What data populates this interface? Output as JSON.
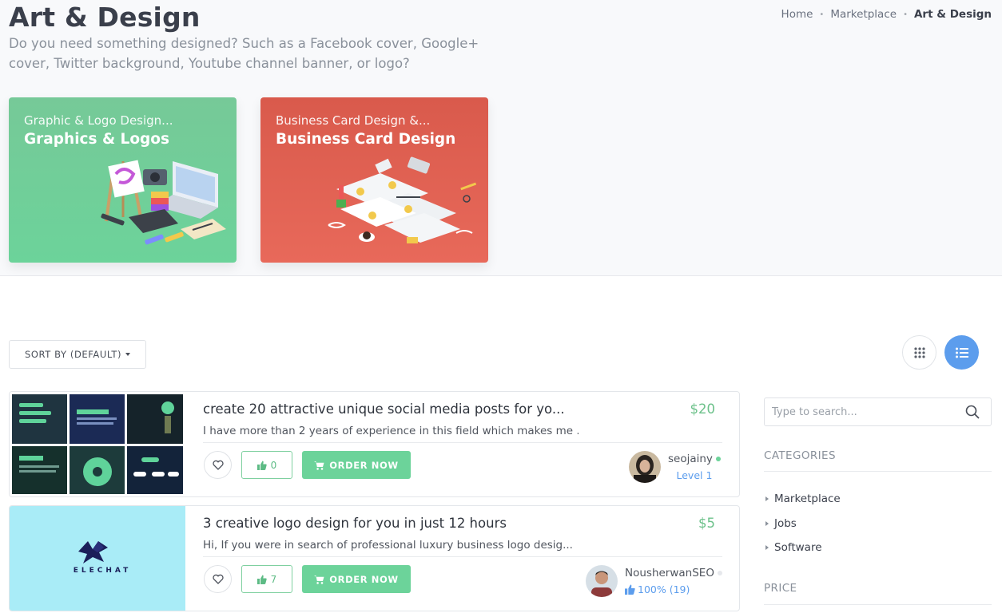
{
  "header": {
    "title": "Art & Design",
    "subtitle": "Do you need something designed? Such as a Facebook cover, Google+ cover, Twitter background, Youtube channel banner, or logo?"
  },
  "breadcrumb": [
    "Home",
    "Marketplace",
    "Art & Design"
  ],
  "categories_cards": [
    {
      "small": "Graphic & Logo Design...",
      "big": "Graphics & Logos",
      "color": "#76c998"
    },
    {
      "small": "Business Card Design &...",
      "big": "Business Card Design",
      "color": "#e0604f"
    }
  ],
  "toolbar": {
    "sort_label": "SORT BY (DEFAULT)",
    "grid_view_icon": "grid-icon",
    "list_view_icon": "list-icon",
    "active_view": "list"
  },
  "listings": [
    {
      "title": "create 20 attractive unique social media posts for yo...",
      "description": "I have more than 2 years of experience in this field which makes me ...",
      "price": "$20",
      "likes": "0",
      "order_label": "ORDER NOW",
      "seller_name": "seojainy",
      "seller_meta": "Level 1",
      "online": true
    },
    {
      "title": "3 creative logo design for you in just 12 hours",
      "description": "Hi, If you were in search of professional luxury business logo desig...",
      "price": "$5",
      "likes": "7",
      "order_label": "ORDER NOW",
      "seller_name": "NousherwanSEO",
      "seller_meta": "100% (19)",
      "online": false,
      "thumb_text": "ELECHAT"
    }
  ],
  "sidebar": {
    "search_placeholder": "Type to search...",
    "categories_heading": "CATEGORIES",
    "categories": [
      "Marketplace",
      "Jobs",
      "Software"
    ],
    "price_heading": "PRICE"
  },
  "colors": {
    "accent_green": "#6cd39a",
    "accent_blue": "#5c9ded",
    "card_green": "#76c998",
    "card_red": "#e0604f"
  }
}
